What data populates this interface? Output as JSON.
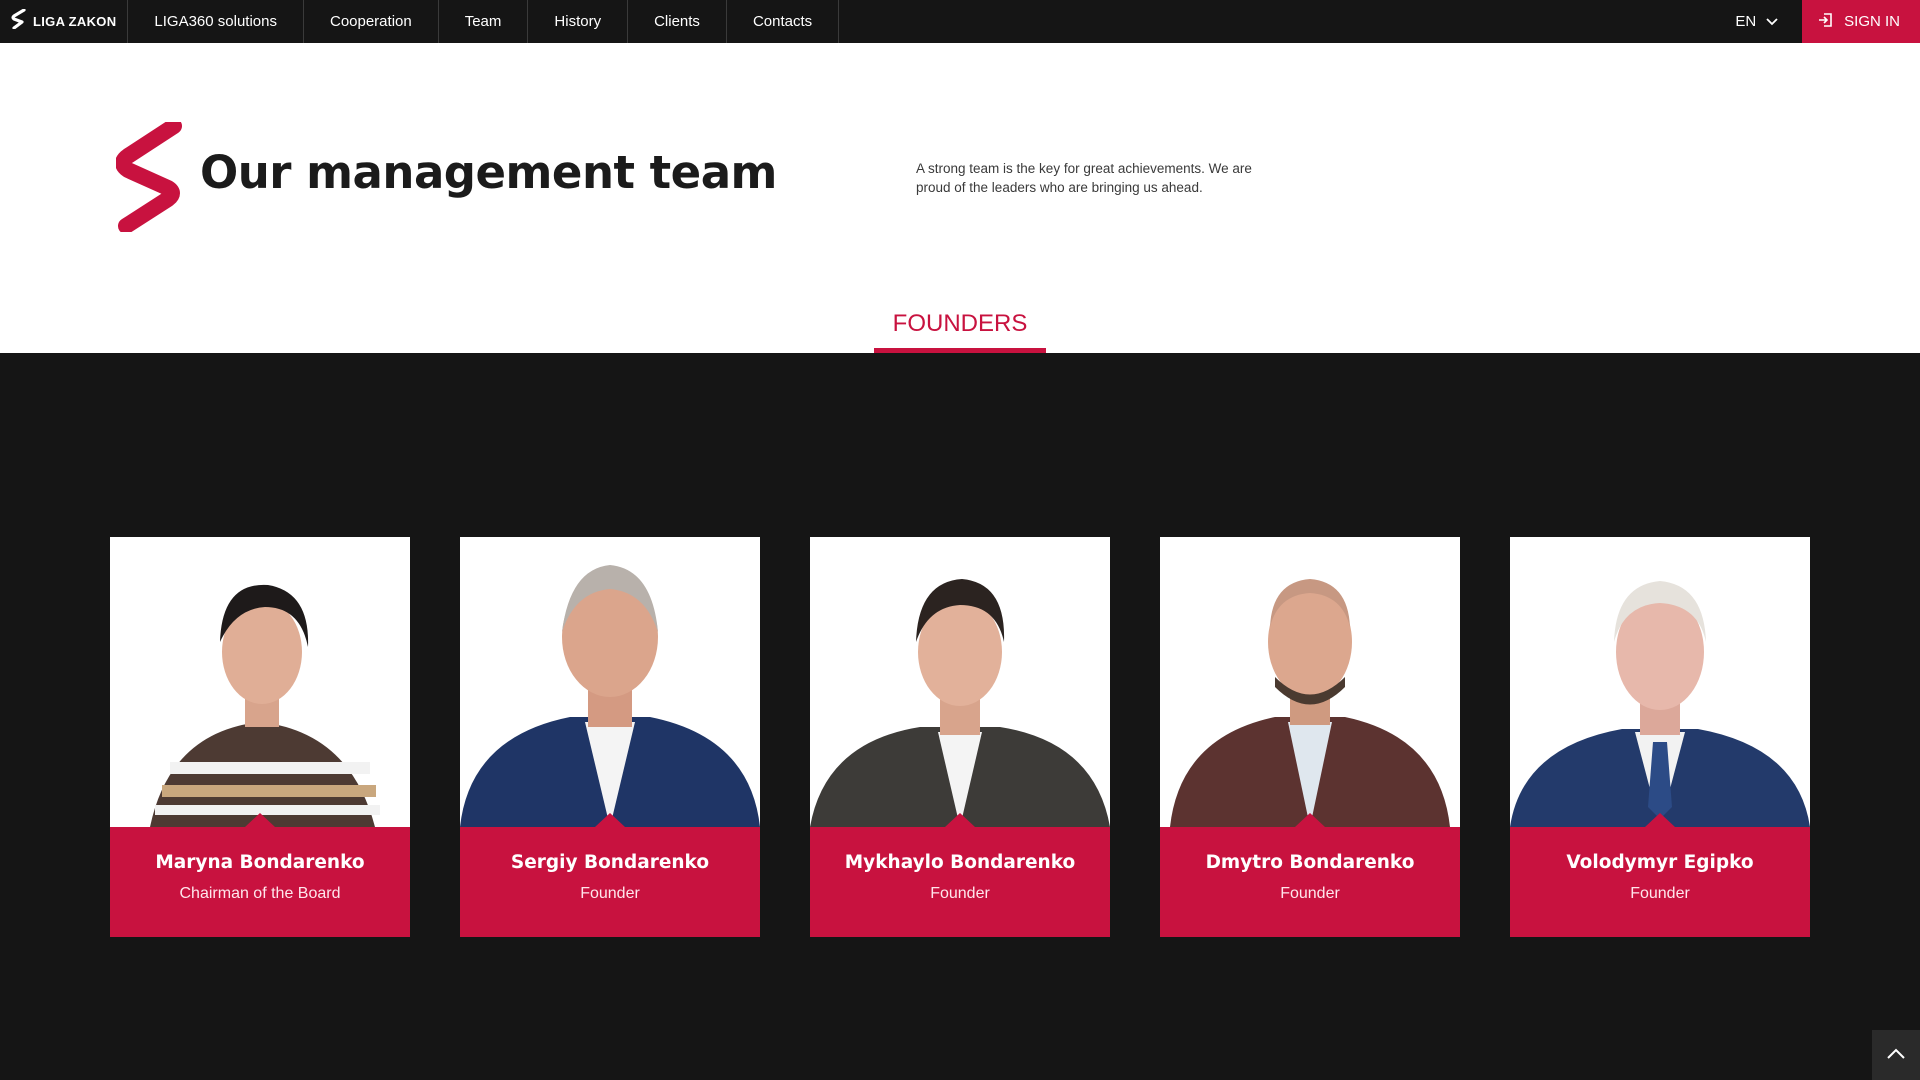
{
  "nav": {
    "brand": "LIGA ZAKON",
    "items": [
      "LIGA360 solutions",
      "Cooperation",
      "Team",
      "History",
      "Clients",
      "Contacts"
    ],
    "language": "EN",
    "signin": "SIGN IN"
  },
  "hero": {
    "title": "Our management team",
    "description": "A strong team is the key for great achievements. We are proud of the leaders who are bringing us ahead."
  },
  "tabs": {
    "active": "FOUNDERS"
  },
  "team": [
    {
      "name": "Maryna Bondarenko",
      "role": "Chairman of the Board"
    },
    {
      "name": "Sergiy Bondarenko",
      "role": "Founder"
    },
    {
      "name": "Mykhaylo Bondarenko",
      "role": "Founder"
    },
    {
      "name": "Dmytro Bondarenko",
      "role": "Founder"
    },
    {
      "name": "Volodymyr Egipko",
      "role": "Founder"
    }
  ],
  "colors": {
    "accent": "#c8123f",
    "nav_bg": "#151515",
    "section_bg": "#151515"
  },
  "icons": {
    "brand": "liga-s-logo-icon",
    "language": "chevron-down-icon",
    "signin": "sign-in-icon",
    "scroll": "chevron-up-icon"
  }
}
